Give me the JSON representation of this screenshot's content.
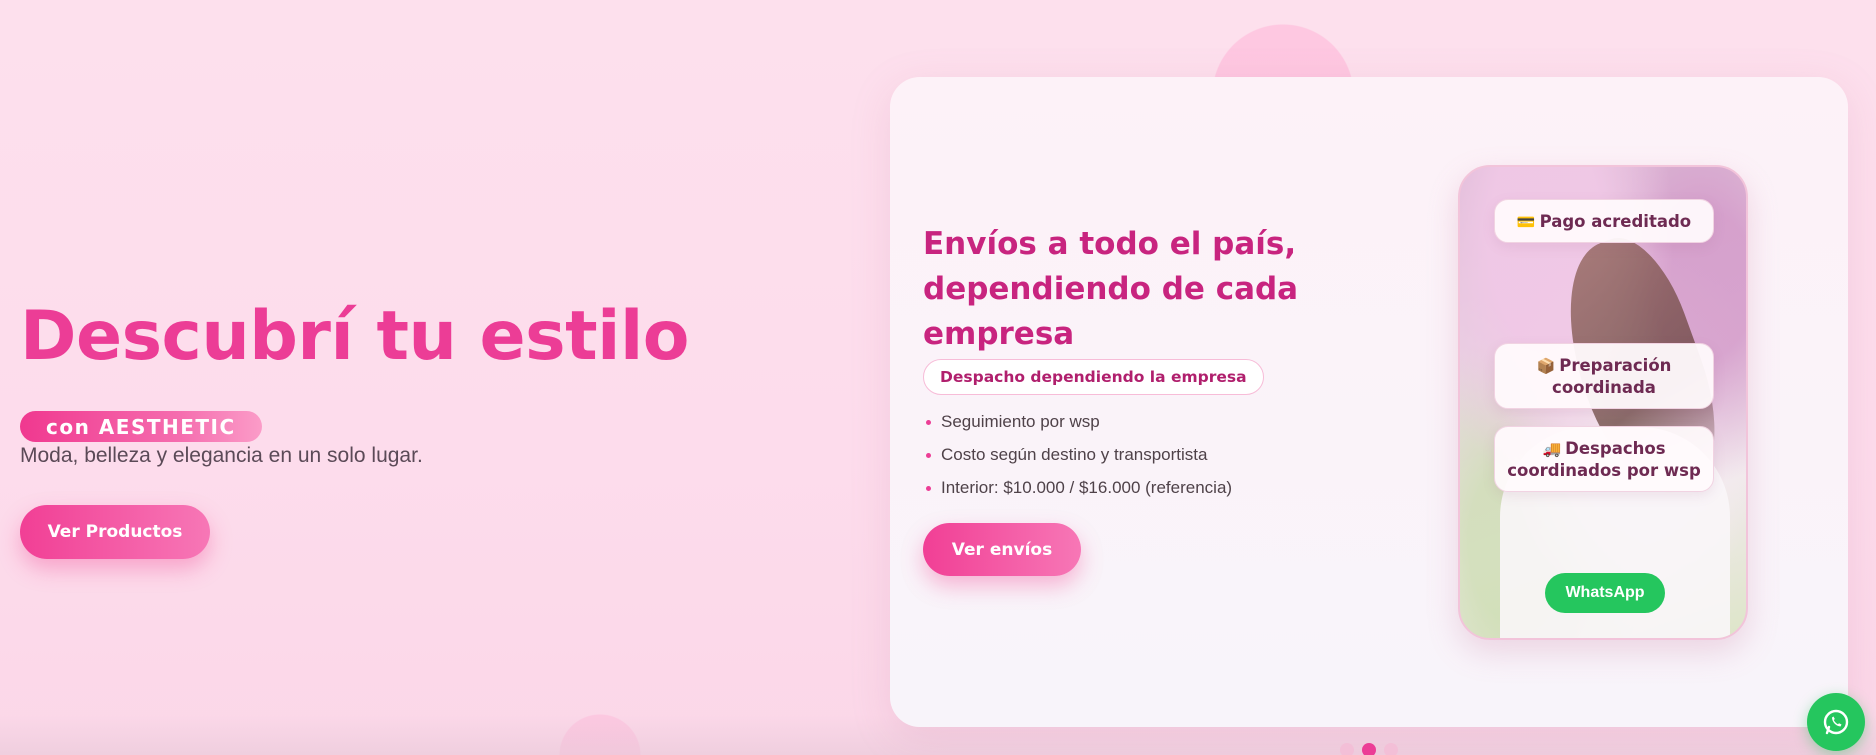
{
  "hero": {
    "title": "Descubrí tu estilo",
    "brand_pill": "con AESTHETIC",
    "subtitle": "Moda, belleza y elegancia en un solo lugar.",
    "cta_label": "Ver Productos"
  },
  "slide": {
    "title": "Envíos a todo el país, dependiendo de cada empresa",
    "badge": "Despacho dependiendo la empresa",
    "features": [
      "Seguimiento por wsp",
      "Costo según destino y transportista",
      "Interior: $10.000 / $16.000 (referencia)"
    ],
    "cta_label": "Ver envíos",
    "phone": {
      "cards": [
        {
          "icon": "credit-card-icon",
          "glyph": "💳",
          "label": "Pago acreditado"
        },
        {
          "icon": "package-icon",
          "glyph": "📦",
          "label": "Preparación coordinada"
        },
        {
          "icon": "truck-icon",
          "glyph": "🚚",
          "label": "Despachos coordinados por wsp"
        }
      ],
      "whatsapp_label": "WhatsApp"
    }
  },
  "carousel": {
    "total": 3,
    "active_index": 1
  },
  "colors": {
    "accent": "#ec3d96",
    "card_title": "#c8247f",
    "whatsapp": "#25c65e",
    "background": "#fde1ee"
  }
}
